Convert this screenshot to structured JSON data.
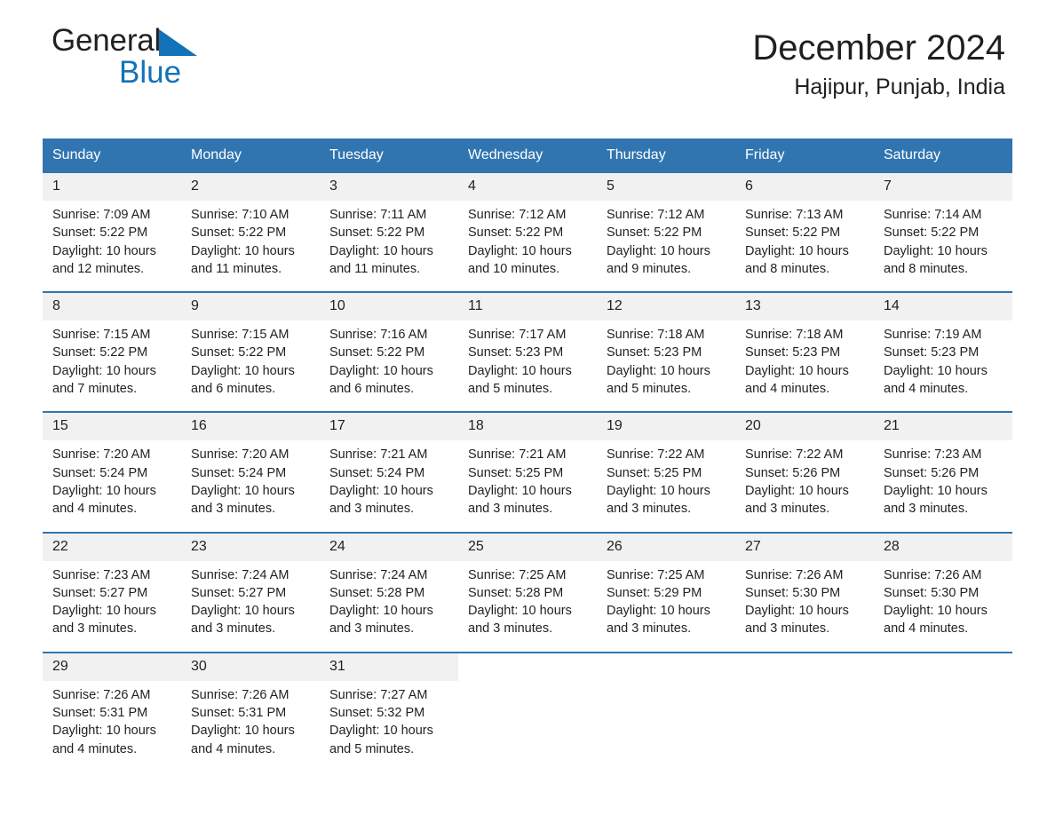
{
  "brand": {
    "name_part1": "General",
    "name_part2": "Blue",
    "triangle_color": "#1472b8",
    "text_color": "#231f20"
  },
  "header": {
    "title": "December 2024",
    "subtitle": "Hajipur, Punjab, India"
  },
  "theme": {
    "header_blue": "#3175b0",
    "daynum_background": "#f1f1f1",
    "row_divider": "#3175b0",
    "text": "#231f20"
  },
  "calendar": {
    "weekdays": [
      "Sunday",
      "Monday",
      "Tuesday",
      "Wednesday",
      "Thursday",
      "Friday",
      "Saturday"
    ],
    "weeks": [
      [
        {
          "day": "1",
          "sunrise": "Sunrise: 7:09 AM",
          "sunset": "Sunset: 5:22 PM",
          "daylight_line1": "Daylight: 10 hours",
          "daylight_line2": "and 12 minutes."
        },
        {
          "day": "2",
          "sunrise": "Sunrise: 7:10 AM",
          "sunset": "Sunset: 5:22 PM",
          "daylight_line1": "Daylight: 10 hours",
          "daylight_line2": "and 11 minutes."
        },
        {
          "day": "3",
          "sunrise": "Sunrise: 7:11 AM",
          "sunset": "Sunset: 5:22 PM",
          "daylight_line1": "Daylight: 10 hours",
          "daylight_line2": "and 11 minutes."
        },
        {
          "day": "4",
          "sunrise": "Sunrise: 7:12 AM",
          "sunset": "Sunset: 5:22 PM",
          "daylight_line1": "Daylight: 10 hours",
          "daylight_line2": "and 10 minutes."
        },
        {
          "day": "5",
          "sunrise": "Sunrise: 7:12 AM",
          "sunset": "Sunset: 5:22 PM",
          "daylight_line1": "Daylight: 10 hours",
          "daylight_line2": "and 9 minutes."
        },
        {
          "day": "6",
          "sunrise": "Sunrise: 7:13 AM",
          "sunset": "Sunset: 5:22 PM",
          "daylight_line1": "Daylight: 10 hours",
          "daylight_line2": "and 8 minutes."
        },
        {
          "day": "7",
          "sunrise": "Sunrise: 7:14 AM",
          "sunset": "Sunset: 5:22 PM",
          "daylight_line1": "Daylight: 10 hours",
          "daylight_line2": "and 8 minutes."
        }
      ],
      [
        {
          "day": "8",
          "sunrise": "Sunrise: 7:15 AM",
          "sunset": "Sunset: 5:22 PM",
          "daylight_line1": "Daylight: 10 hours",
          "daylight_line2": "and 7 minutes."
        },
        {
          "day": "9",
          "sunrise": "Sunrise: 7:15 AM",
          "sunset": "Sunset: 5:22 PM",
          "daylight_line1": "Daylight: 10 hours",
          "daylight_line2": "and 6 minutes."
        },
        {
          "day": "10",
          "sunrise": "Sunrise: 7:16 AM",
          "sunset": "Sunset: 5:22 PM",
          "daylight_line1": "Daylight: 10 hours",
          "daylight_line2": "and 6 minutes."
        },
        {
          "day": "11",
          "sunrise": "Sunrise: 7:17 AM",
          "sunset": "Sunset: 5:23 PM",
          "daylight_line1": "Daylight: 10 hours",
          "daylight_line2": "and 5 minutes."
        },
        {
          "day": "12",
          "sunrise": "Sunrise: 7:18 AM",
          "sunset": "Sunset: 5:23 PM",
          "daylight_line1": "Daylight: 10 hours",
          "daylight_line2": "and 5 minutes."
        },
        {
          "day": "13",
          "sunrise": "Sunrise: 7:18 AM",
          "sunset": "Sunset: 5:23 PM",
          "daylight_line1": "Daylight: 10 hours",
          "daylight_line2": "and 4 minutes."
        },
        {
          "day": "14",
          "sunrise": "Sunrise: 7:19 AM",
          "sunset": "Sunset: 5:23 PM",
          "daylight_line1": "Daylight: 10 hours",
          "daylight_line2": "and 4 minutes."
        }
      ],
      [
        {
          "day": "15",
          "sunrise": "Sunrise: 7:20 AM",
          "sunset": "Sunset: 5:24 PM",
          "daylight_line1": "Daylight: 10 hours",
          "daylight_line2": "and 4 minutes."
        },
        {
          "day": "16",
          "sunrise": "Sunrise: 7:20 AM",
          "sunset": "Sunset: 5:24 PM",
          "daylight_line1": "Daylight: 10 hours",
          "daylight_line2": "and 3 minutes."
        },
        {
          "day": "17",
          "sunrise": "Sunrise: 7:21 AM",
          "sunset": "Sunset: 5:24 PM",
          "daylight_line1": "Daylight: 10 hours",
          "daylight_line2": "and 3 minutes."
        },
        {
          "day": "18",
          "sunrise": "Sunrise: 7:21 AM",
          "sunset": "Sunset: 5:25 PM",
          "daylight_line1": "Daylight: 10 hours",
          "daylight_line2": "and 3 minutes."
        },
        {
          "day": "19",
          "sunrise": "Sunrise: 7:22 AM",
          "sunset": "Sunset: 5:25 PM",
          "daylight_line1": "Daylight: 10 hours",
          "daylight_line2": "and 3 minutes."
        },
        {
          "day": "20",
          "sunrise": "Sunrise: 7:22 AM",
          "sunset": "Sunset: 5:26 PM",
          "daylight_line1": "Daylight: 10 hours",
          "daylight_line2": "and 3 minutes."
        },
        {
          "day": "21",
          "sunrise": "Sunrise: 7:23 AM",
          "sunset": "Sunset: 5:26 PM",
          "daylight_line1": "Daylight: 10 hours",
          "daylight_line2": "and 3 minutes."
        }
      ],
      [
        {
          "day": "22",
          "sunrise": "Sunrise: 7:23 AM",
          "sunset": "Sunset: 5:27 PM",
          "daylight_line1": "Daylight: 10 hours",
          "daylight_line2": "and 3 minutes."
        },
        {
          "day": "23",
          "sunrise": "Sunrise: 7:24 AM",
          "sunset": "Sunset: 5:27 PM",
          "daylight_line1": "Daylight: 10 hours",
          "daylight_line2": "and 3 minutes."
        },
        {
          "day": "24",
          "sunrise": "Sunrise: 7:24 AM",
          "sunset": "Sunset: 5:28 PM",
          "daylight_line1": "Daylight: 10 hours",
          "daylight_line2": "and 3 minutes."
        },
        {
          "day": "25",
          "sunrise": "Sunrise: 7:25 AM",
          "sunset": "Sunset: 5:28 PM",
          "daylight_line1": "Daylight: 10 hours",
          "daylight_line2": "and 3 minutes."
        },
        {
          "day": "26",
          "sunrise": "Sunrise: 7:25 AM",
          "sunset": "Sunset: 5:29 PM",
          "daylight_line1": "Daylight: 10 hours",
          "daylight_line2": "and 3 minutes."
        },
        {
          "day": "27",
          "sunrise": "Sunrise: 7:26 AM",
          "sunset": "Sunset: 5:30 PM",
          "daylight_line1": "Daylight: 10 hours",
          "daylight_line2": "and 3 minutes."
        },
        {
          "day": "28",
          "sunrise": "Sunrise: 7:26 AM",
          "sunset": "Sunset: 5:30 PM",
          "daylight_line1": "Daylight: 10 hours",
          "daylight_line2": "and 4 minutes."
        }
      ],
      [
        {
          "day": "29",
          "sunrise": "Sunrise: 7:26 AM",
          "sunset": "Sunset: 5:31 PM",
          "daylight_line1": "Daylight: 10 hours",
          "daylight_line2": "and 4 minutes."
        },
        {
          "day": "30",
          "sunrise": "Sunrise: 7:26 AM",
          "sunset": "Sunset: 5:31 PM",
          "daylight_line1": "Daylight: 10 hours",
          "daylight_line2": "and 4 minutes."
        },
        {
          "day": "31",
          "sunrise": "Sunrise: 7:27 AM",
          "sunset": "Sunset: 5:32 PM",
          "daylight_line1": "Daylight: 10 hours",
          "daylight_line2": "and 5 minutes."
        },
        {
          "day": "",
          "sunrise": "",
          "sunset": "",
          "daylight_line1": "",
          "daylight_line2": ""
        },
        {
          "day": "",
          "sunrise": "",
          "sunset": "",
          "daylight_line1": "",
          "daylight_line2": ""
        },
        {
          "day": "",
          "sunrise": "",
          "sunset": "",
          "daylight_line1": "",
          "daylight_line2": ""
        },
        {
          "day": "",
          "sunrise": "",
          "sunset": "",
          "daylight_line1": "",
          "daylight_line2": ""
        }
      ]
    ]
  }
}
